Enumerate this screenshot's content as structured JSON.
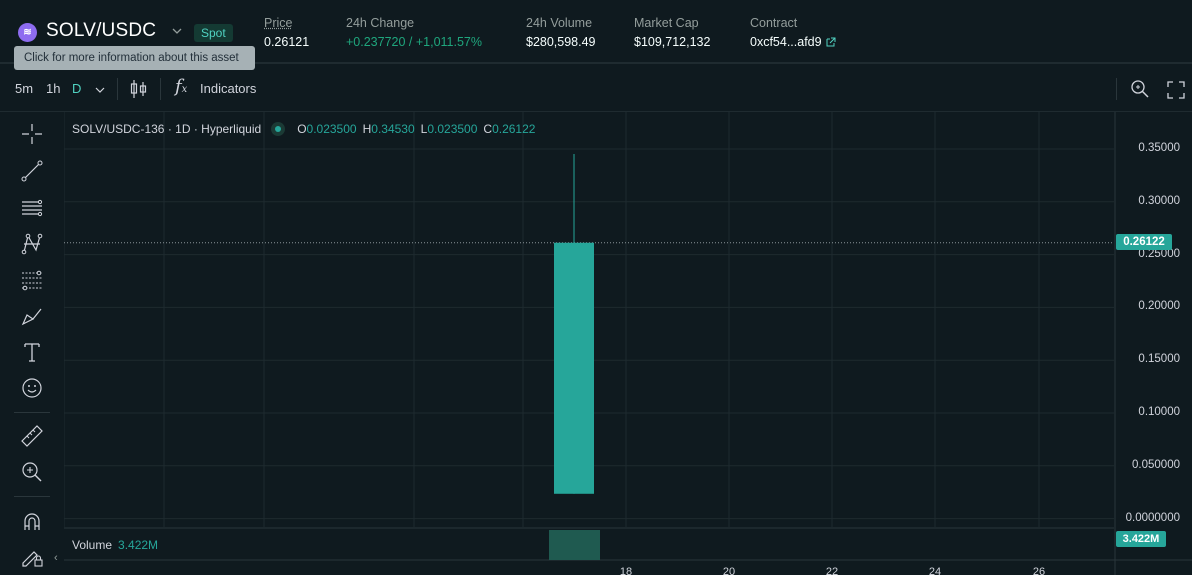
{
  "header": {
    "asset_name": "SOLV/USDC",
    "market_type": "Spot",
    "tooltip": "Click for more information about this asset",
    "stats": {
      "price_label": "Price",
      "price_value": "0.26121",
      "change_label": "24h Change",
      "change_value": "+0.237720 / +1,011.57%",
      "volume_label": "24h Volume",
      "volume_value": "$280,598.49",
      "mcap_label": "Market Cap",
      "mcap_value": "$109,712,132",
      "contract_label": "Contract",
      "contract_value": "0xcf54...afd9"
    }
  },
  "toolbar": {
    "intervals": [
      "5m",
      "1h",
      "D"
    ],
    "active_interval": "D",
    "indicators_label": "Indicators"
  },
  "chart": {
    "legend": {
      "symbol": "SOLV/USDC-136 · 1D · Hyperliquid",
      "o_label": "O",
      "o_value": "0.023500",
      "h_label": "H",
      "h_value": "0.34530",
      "l_label": "L",
      "l_value": "0.023500",
      "c_label": "C",
      "c_value": "0.26122"
    },
    "y_ticks": [
      "0.35000",
      "0.30000",
      "0.25000",
      "0.20000",
      "0.15000",
      "0.10000",
      "0.050000",
      "0.0000000"
    ],
    "last_price_tag": "0.26122",
    "volume_label": "Volume",
    "volume_value": "3.422M",
    "volume_tag": "3.422M",
    "x_ticks": [
      "18",
      "20",
      "22",
      "24",
      "26"
    ],
    "colors": {
      "up": "#26a69a",
      "background": "#0f1a1f",
      "grid": "#1e2a2f"
    }
  },
  "chart_data": {
    "type": "candlestick",
    "candles": [
      {
        "open": 0.0235,
        "high": 0.3453,
        "low": 0.0235,
        "close": 0.26122,
        "volume_label": "3.422M"
      }
    ],
    "y_ticks": [
      0.35,
      0.3,
      0.25,
      0.2,
      0.15,
      0.1,
      0.05,
      0
    ],
    "x_ticks": [
      "18",
      "20",
      "22",
      "24",
      "26"
    ]
  }
}
